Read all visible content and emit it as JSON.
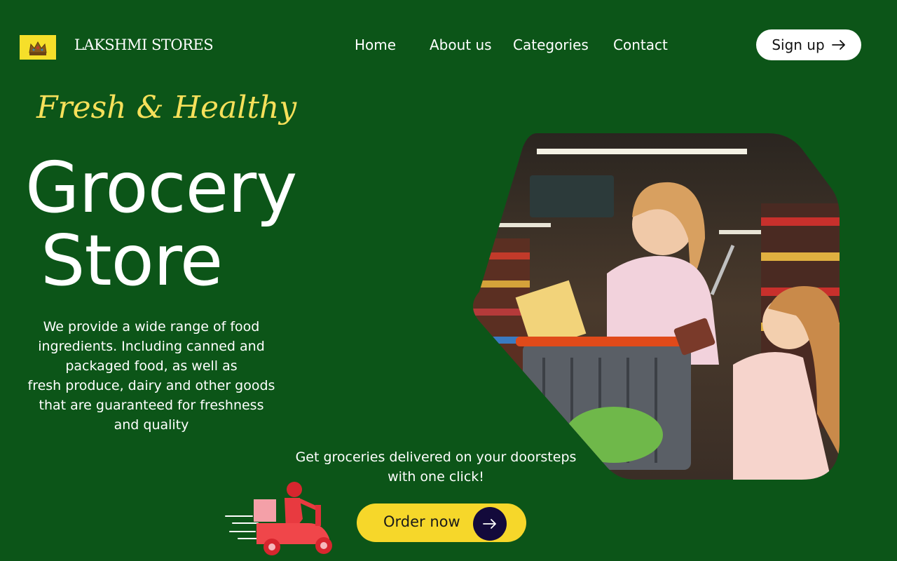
{
  "header": {
    "logo_icon": "crown-logo-icon",
    "brand": "LAKSHMI STORES",
    "nav": {
      "home": "Home",
      "about": "About us",
      "categories": "Categories",
      "contact": "Contact"
    },
    "signup_label": "Sign up",
    "signup_icon": "arrow-right-icon"
  },
  "hero": {
    "tagline": "Fresh & Healthy",
    "title_line1": "Grocery",
    "title_line2": "Store",
    "description": [
      "We provide a wide range of food",
      "ingredients.  Including canned and",
      "packaged food, as well as",
      "fresh produce, dairy and other goods",
      "that are guaranteed for freshness",
      "and quality"
    ],
    "image_icon": "mother-daughter-shopping-photo"
  },
  "delivery": {
    "text": [
      "Get groceries delivered on your doorsteps",
      "with one click!"
    ],
    "order_label": "Order now",
    "order_icon": "arrow-right-icon",
    "scooter_icon": "delivery-scooter-icon"
  },
  "colors": {
    "background": "#0c5518",
    "accent_yellow": "#f6d72a",
    "tagline": "#f6e05a",
    "arrow_circle": "#130a3b"
  }
}
